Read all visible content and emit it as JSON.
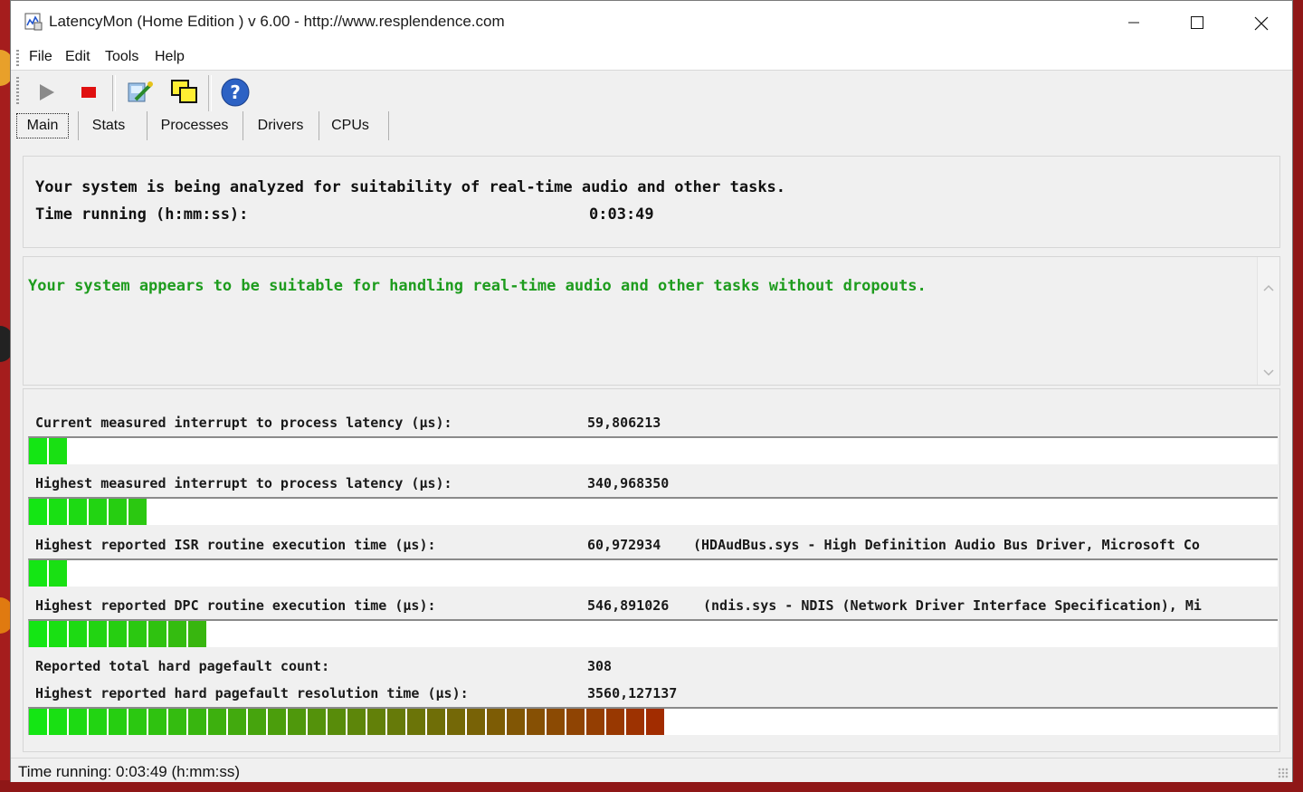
{
  "window": {
    "title": "LatencyMon  (Home Edition )  v 6.00 - http://www.resplendence.com"
  },
  "menu": {
    "items": [
      "File",
      "Edit",
      "Tools",
      "Help"
    ]
  },
  "toolbar": {
    "buttons": [
      "play-icon",
      "stop-icon",
      "settings-icon",
      "windows-icon",
      "help-icon"
    ]
  },
  "tabs": [
    "Main",
    "Stats",
    "Processes",
    "Drivers",
    "CPUs"
  ],
  "analysis": {
    "line1": "Your system is being analyzed for suitability of real-time audio and other tasks.",
    "time_label": "Time running (h:mm:ss):",
    "time_value": "0:03:49"
  },
  "verdict": {
    "message": "Your system appears to be suitable for handling real-time audio and other tasks without dropouts.",
    "color": "#1e9c1e"
  },
  "metrics": [
    {
      "label": "Current measured interrupt to process latency (µs):",
      "value": "59,806213",
      "extra": "",
      "bar_fraction": 0.027
    },
    {
      "label": "Highest measured interrupt to process latency (µs):",
      "value": "340,968350",
      "extra": "",
      "bar_fraction": 0.1
    },
    {
      "label": "Highest reported ISR routine execution time (µs):",
      "value": "60,972934",
      "extra": "(HDAudBus.sys - High Definition Audio Bus Driver, Microsoft Co",
      "bar_fraction": 0.027
    },
    {
      "label": "Highest reported DPC routine execution time (µs):",
      "value": "546,891026",
      "extra": "(ndis.sys - NDIS (Network Driver Interface Specification), Mi",
      "bar_fraction": 0.155
    },
    {
      "label": "Reported total hard pagefault count:",
      "value": "308",
      "extra": ""
    },
    {
      "label": "Highest reported hard pagefault resolution time (µs):",
      "value": "3560,127137",
      "extra": "",
      "bar_fraction": 0.555
    }
  ],
  "colors": {
    "bar_green": "#14e614",
    "bar_red": "#a32a00"
  },
  "status": {
    "text": "Time running: 0:03:49  (h:mm:ss)"
  }
}
